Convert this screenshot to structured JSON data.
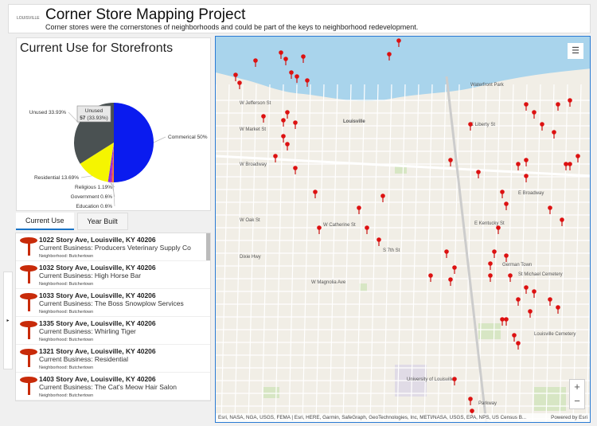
{
  "header": {
    "title": "Corner Store Mapping Project",
    "subtitle": "Corner stores were the cornerstones of neighborhoods and could be part of the keys to neighborhood redevelopment.",
    "logo_text": "LOUISVILLE"
  },
  "chart_data": {
    "type": "pie",
    "title": "Current Use for Storefronts",
    "slices": [
      {
        "label": "Commerical",
        "value": 84,
        "percent": 50,
        "color": "#0a1bef",
        "text": "Commerical 50%"
      },
      {
        "label": "Education",
        "value": 1,
        "percent": 0.6,
        "color": "#f08a1c",
        "text": "Education 0.6%"
      },
      {
        "label": "Government",
        "value": 1,
        "percent": 0.6,
        "color": "#d92f8a",
        "text": "Government 0.6%"
      },
      {
        "label": "Religious",
        "value": 2,
        "percent": 1.19,
        "color": "#8a2be2",
        "text": "Religious 1.19%"
      },
      {
        "label": "Residential",
        "value": 23,
        "percent": 13.69,
        "color": "#f5f500",
        "text": "Residential 13.69%"
      },
      {
        "label": "Unused",
        "value": 57,
        "percent": 33.93,
        "color": "#4a5152",
        "text": "Unused 33.93%"
      }
    ],
    "tooltip": {
      "label": "Unused",
      "value": "57",
      "percent": "(33.93%)"
    }
  },
  "tabs": [
    {
      "label": "Current Use"
    },
    {
      "label": "Year Built"
    }
  ],
  "list": [
    {
      "address": "1022 Story Ave, Louisville, KY 40206",
      "business": "Current Business: Producers Veterinary Supply Co",
      "neighborhood": "Neighborhood: Butchertown"
    },
    {
      "address": "1032 Story Ave, Louisville, KY 40206",
      "business": "Current Business: High Horse Bar",
      "neighborhood": "Neighborhood: Butchertown"
    },
    {
      "address": "1033 Story Ave, Louisville, KY 40206",
      "business": "Current Business: The Boss Snowplow Services",
      "neighborhood": "Neighborhood: Butchertown"
    },
    {
      "address": "1335 Story Ave, Louisville, KY 40206",
      "business": "Current Business: Whirling Tiger",
      "neighborhood": "Neighborhood: Butchertown"
    },
    {
      "address": "1321 Story Ave, Louisville, KY 40206",
      "business": "Current Business: Residential",
      "neighborhood": "Neighborhood: Butchertown"
    },
    {
      "address": "1403 Story Ave, Louisville, KY 40206",
      "business": "Current Business: The Cat's Meow Hair Salon",
      "neighborhood": "Neighborhood: Butchertown"
    }
  ],
  "map": {
    "labels": [
      "Louisville",
      "Waterfront Park",
      "W Jefferson St",
      "W Broadway",
      "E Broadway",
      "German Town",
      "St Michael Cemetery",
      "Louisville Cemetery",
      "University of Louisville",
      "Parkway",
      "W Oak St",
      "E Kentucky St",
      "W Market St",
      "E Liberty St",
      "W Magnolia Ave",
      "Dixie Hwy",
      "S 7th St",
      "W Catherine St"
    ],
    "attribution": "Esri, NASA, NGA, USGS, FEMA | Esri, HERE, Garmin, SafeGraph, GeoTechnologies, Inc, METI/NASA, USGS, EPA, NPS, US Census B...",
    "powered": "Powered by Esri",
    "zoom_in": "+",
    "zoom_out": "−",
    "legend_icon": "☰"
  },
  "collapse_icon": "▸"
}
